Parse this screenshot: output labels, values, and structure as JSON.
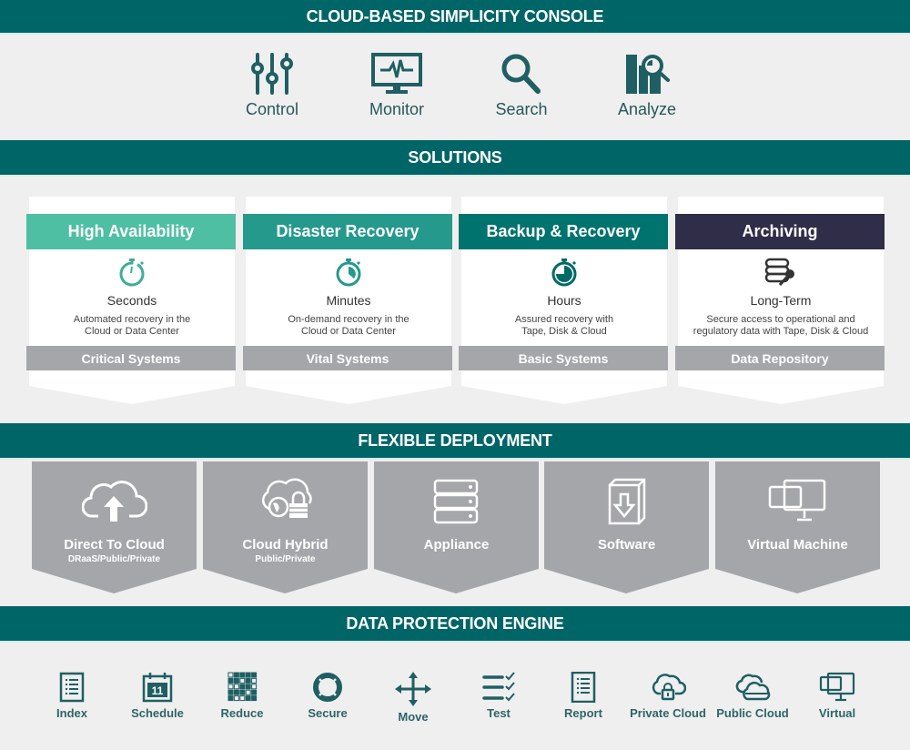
{
  "colors": {
    "banner": "#006567",
    "teal_dark": "#1f5f63",
    "high_availability": "#4fbfa4",
    "disaster_recovery": "#25998c",
    "backup_recovery": "#00736e",
    "archiving": "#302d48",
    "gray": "#a4a6a9"
  },
  "console": {
    "title": "CLOUD-BASED SIMPLICITY CONSOLE",
    "items": [
      {
        "label": "Control",
        "icon": "sliders-icon"
      },
      {
        "label": "Monitor",
        "icon": "monitor-pulse-icon"
      },
      {
        "label": "Search",
        "icon": "magnifier-icon"
      },
      {
        "label": "Analyze",
        "icon": "chart-magnifier-icon"
      }
    ]
  },
  "solutions": {
    "title": "SOLUTIONS",
    "items": [
      {
        "heading": "High Availability",
        "metric": "Seconds",
        "description_line1": "Automated recovery in the",
        "description_line2": "Cloud or Data Center",
        "footer": "Critical Systems",
        "icon": "stopwatch-seconds-icon"
      },
      {
        "heading": "Disaster Recovery",
        "metric": "Minutes",
        "description_line1": "On-demand recovery in the",
        "description_line2": "Cloud or Data Center",
        "footer": "Vital Systems",
        "icon": "stopwatch-minutes-icon"
      },
      {
        "heading": "Backup & Recovery",
        "metric": "Hours",
        "description_line1": "Assured recovery with",
        "description_line2": "Tape, Disk & Cloud",
        "footer": "Basic Systems",
        "icon": "stopwatch-hours-icon"
      },
      {
        "heading": "Archiving",
        "metric": "Long-Term",
        "description_line1": "Secure access to operational and",
        "description_line2": "regulatory data with Tape, Disk & Cloud",
        "footer": "Data Repository",
        "icon": "database-key-icon"
      }
    ]
  },
  "deployment": {
    "title": "FLEXIBLE DEPLOYMENT",
    "items": [
      {
        "label": "Direct To Cloud",
        "sublabel": "DRaaS/Public/Private",
        "icon": "cloud-upload-icon"
      },
      {
        "label": "Cloud Hybrid",
        "sublabel": "Public/Private",
        "icon": "cloud-globe-lock-icon"
      },
      {
        "label": "Appliance",
        "sublabel": "",
        "icon": "server-stack-icon"
      },
      {
        "label": "Software",
        "sublabel": "",
        "icon": "software-box-icon"
      },
      {
        "label": "Virtual Machine",
        "sublabel": "",
        "icon": "virtual-monitors-icon"
      }
    ]
  },
  "engine": {
    "title": "DATA PROTECTION ENGINE",
    "items": [
      {
        "label": "Index",
        "icon": "document-list-icon"
      },
      {
        "label": "Schedule",
        "icon": "calendar-icon"
      },
      {
        "label": "Reduce",
        "icon": "dedupe-grid-icon"
      },
      {
        "label": "Secure",
        "icon": "lifebuoy-icon"
      },
      {
        "label": "Move",
        "icon": "move-arrows-icon"
      },
      {
        "label": "Test",
        "icon": "checklist-icon"
      },
      {
        "label": "Report",
        "icon": "report-icon"
      },
      {
        "label": "Private Cloud",
        "icon": "cloud-lock-icon"
      },
      {
        "label": "Public Cloud",
        "icon": "double-cloud-icon"
      },
      {
        "label": "Virtual",
        "icon": "virtual-icon"
      }
    ]
  }
}
